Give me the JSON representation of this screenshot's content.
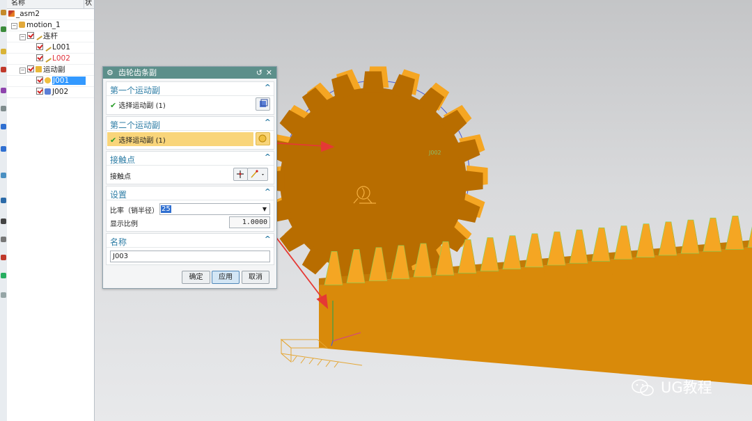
{
  "navigator": {
    "col_name": "名称",
    "col_status": "状",
    "rows": [
      {
        "label": "_asm2",
        "color": "#222222"
      },
      {
        "label": "motion_1",
        "color": "#222222"
      },
      {
        "label": "连杆",
        "color": "#222222"
      },
      {
        "label": "L001",
        "color": "#222222"
      },
      {
        "label": "L002",
        "color": "#e0303a"
      },
      {
        "label": "运动副",
        "color": "#222222"
      },
      {
        "label": "J001",
        "color": "#ffffff"
      },
      {
        "label": "J002",
        "color": "#222222"
      }
    ],
    "selected_row": "J001"
  },
  "dialog": {
    "title": "齿轮齿条副",
    "icons": {
      "settings": "gear-icon",
      "reset": "reset-icon",
      "close": "close-icon"
    },
    "section1": {
      "title": "第一个运动副",
      "select_label": "选择运动副 (1)"
    },
    "section2": {
      "title": "第二个运动副",
      "select_label": "选择运动副 (1)",
      "highlight_color": "#f9d57a"
    },
    "section3": {
      "title": "接触点",
      "label": "接触点"
    },
    "section4": {
      "title": "设置",
      "ratio_label": "比率（销半径）",
      "ratio_value": "25",
      "display_ratio_label": "显示比例",
      "display_ratio_value": "1.0000"
    },
    "section5": {
      "title": "名称",
      "name_value": "J003"
    },
    "buttons": {
      "ok": "确定",
      "apply": "应用",
      "cancel": "取消"
    }
  },
  "viewport": {
    "gear_color": "#c97a00",
    "gear_face_color": "#b86d00",
    "tooth_highlight": "#f5a623",
    "rack_color": "#d98a0a",
    "arrow_color": "#e53935",
    "joint_tag": "J002"
  },
  "watermark": {
    "text": "UG教程",
    "icon": "wechat-icon"
  }
}
